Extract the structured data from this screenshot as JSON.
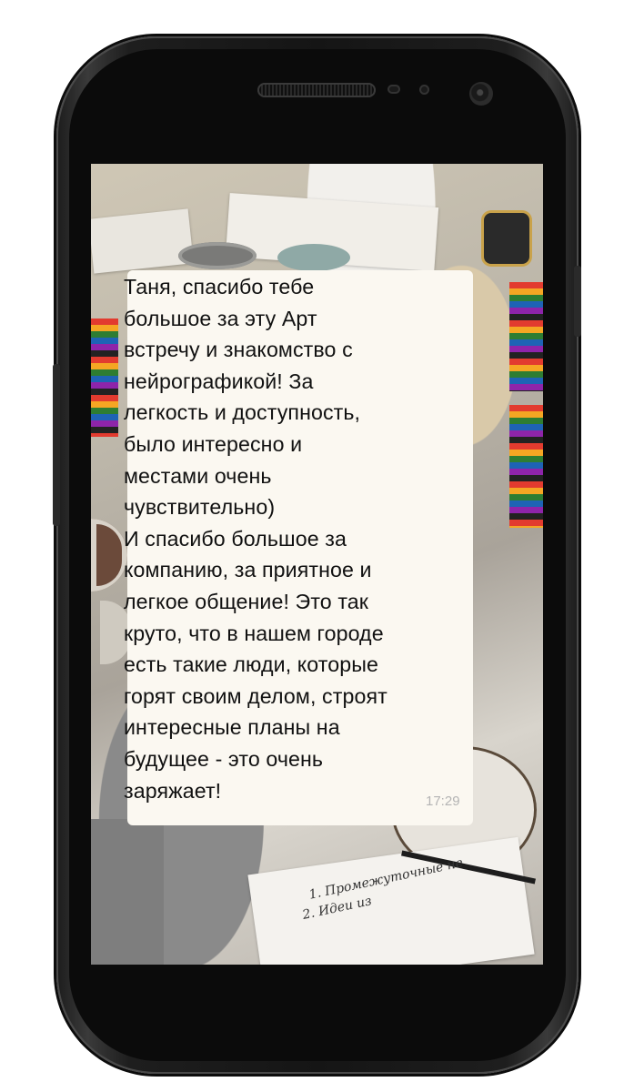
{
  "device": {
    "type": "android-phone",
    "colors": {
      "body": "#151515",
      "screen_background": "#bdb7aa",
      "bubble": "#fbf8f1",
      "text": "#111111",
      "timestamp": "#b4b4b4"
    }
  },
  "chat": {
    "message": {
      "text": "Таня, спасибо тебе\nбольшое за эту Арт\nвстречу и знакомство с\nнейрографикой! За\nлегкость и доступность,\nбыло интересно и\nместами очень\nчувствительно)\nИ спасибо большое за\nкомпанию, за приятное и\nлегкое общение! Это так\nкруто, что в нашем городе\nесть такие люди, которые\nгорят своим делом, строят\nинтересные планы на\nбудущее - это очень\nзаряжает!",
      "time": "17:29",
      "direction": "incoming"
    }
  },
  "background_photo": {
    "handwriting_line_1": "1. Промежуточные не",
    "handwriting_line_2": "2. Идеи из"
  }
}
